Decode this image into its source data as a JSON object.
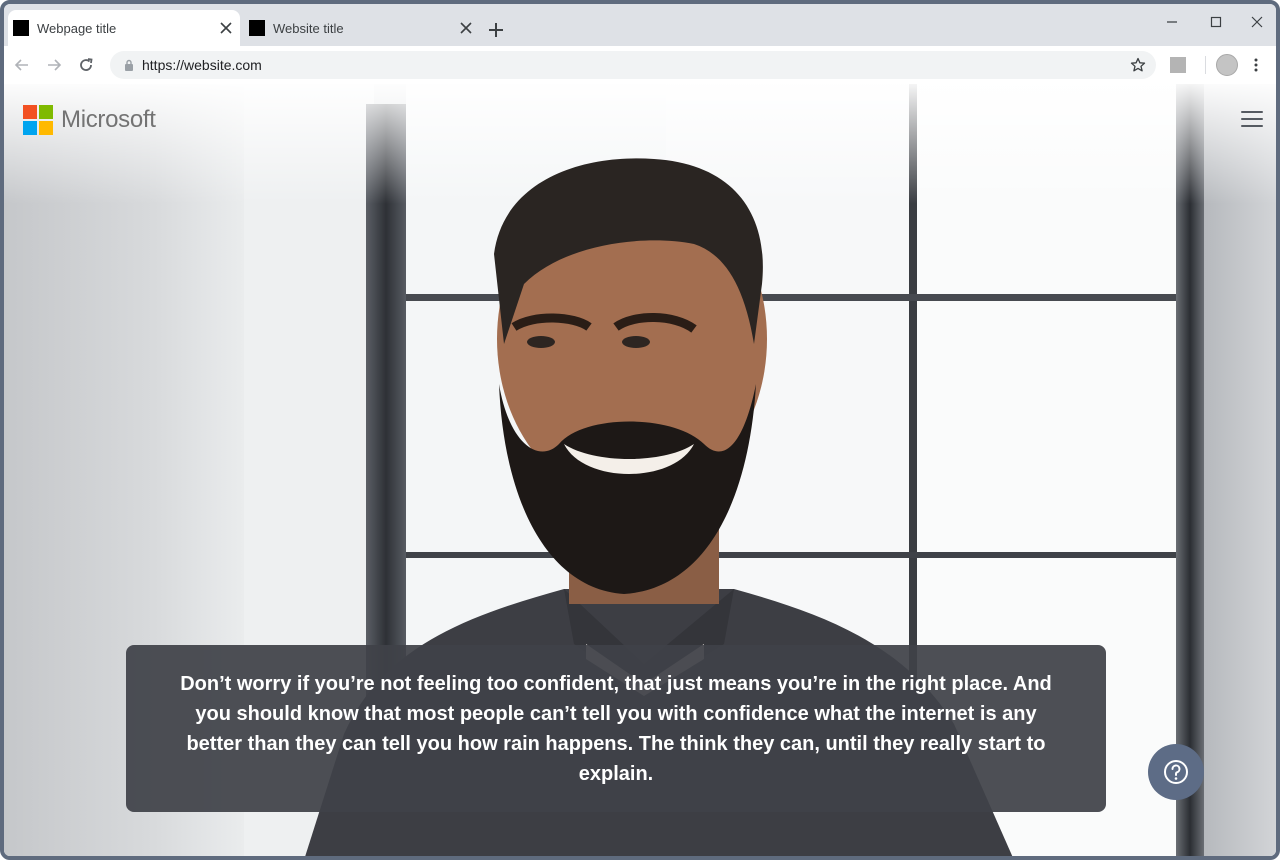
{
  "browser": {
    "tabs": [
      {
        "title": "Webpage title",
        "active": true
      },
      {
        "title": "Website title",
        "active": false
      }
    ],
    "url": "https://website.com"
  },
  "page": {
    "brand": "Microsoft",
    "brand_colors": [
      "#f25022",
      "#7fba00",
      "#00a4ef",
      "#ffb900"
    ],
    "caption": "Don’t worry if you’re not feeling too confident, that just means you’re in the right place. And you should know that most people can’t tell you with confidence what the internet is any better than they can tell you how rain happens. The think they can, until they really start to explain.",
    "help_button_icon": "question-circle-icon",
    "accent": "#5d6c86"
  }
}
